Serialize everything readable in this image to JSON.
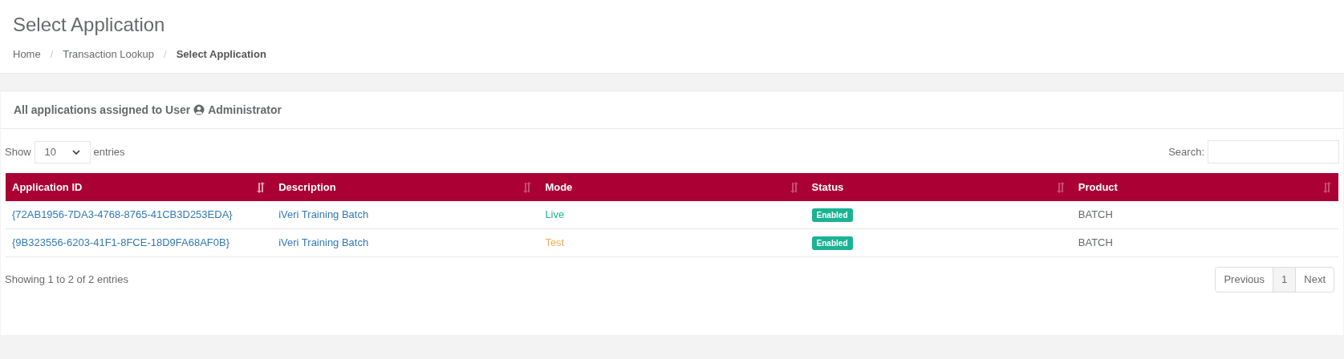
{
  "page_title": "Select Application",
  "breadcrumb": [
    {
      "label": "Home",
      "current": false
    },
    {
      "label": "Transaction Lookup",
      "current": false
    },
    {
      "label": "Select Application",
      "current": true
    }
  ],
  "breadcrumb_separator": "/",
  "panel": {
    "title_prefix": "All applications assigned to User",
    "user": "Administrator"
  },
  "length_menu": {
    "before": "Show",
    "value": "10",
    "after": "entries"
  },
  "search": {
    "label": "Search:"
  },
  "table": {
    "columns": [
      {
        "label": "Application ID",
        "sorted": true
      },
      {
        "label": "Description",
        "sorted": false
      },
      {
        "label": "Mode",
        "sorted": false
      },
      {
        "label": "Status",
        "sorted": false
      },
      {
        "label": "Product",
        "sorted": false
      }
    ],
    "rows": [
      {
        "application_id": "{72AB1956-7DA3-4768-8765-41CB3D253EDA}",
        "description": "iVeri Training Batch",
        "mode": {
          "text": "Live",
          "kind": "live"
        },
        "status": "Enabled",
        "product": "BATCH"
      },
      {
        "application_id": "{9B323556-6203-41F1-8FCE-18D9FA68AF0B}",
        "description": "iVeri Training Batch",
        "mode": {
          "text": "Test",
          "kind": "test"
        },
        "status": "Enabled",
        "product": "BATCH"
      }
    ]
  },
  "info": "Showing 1 to 2 of 2 entries",
  "pagination": {
    "previous": "Previous",
    "pages": [
      {
        "label": "1",
        "selected": true
      }
    ],
    "next": "Next"
  }
}
